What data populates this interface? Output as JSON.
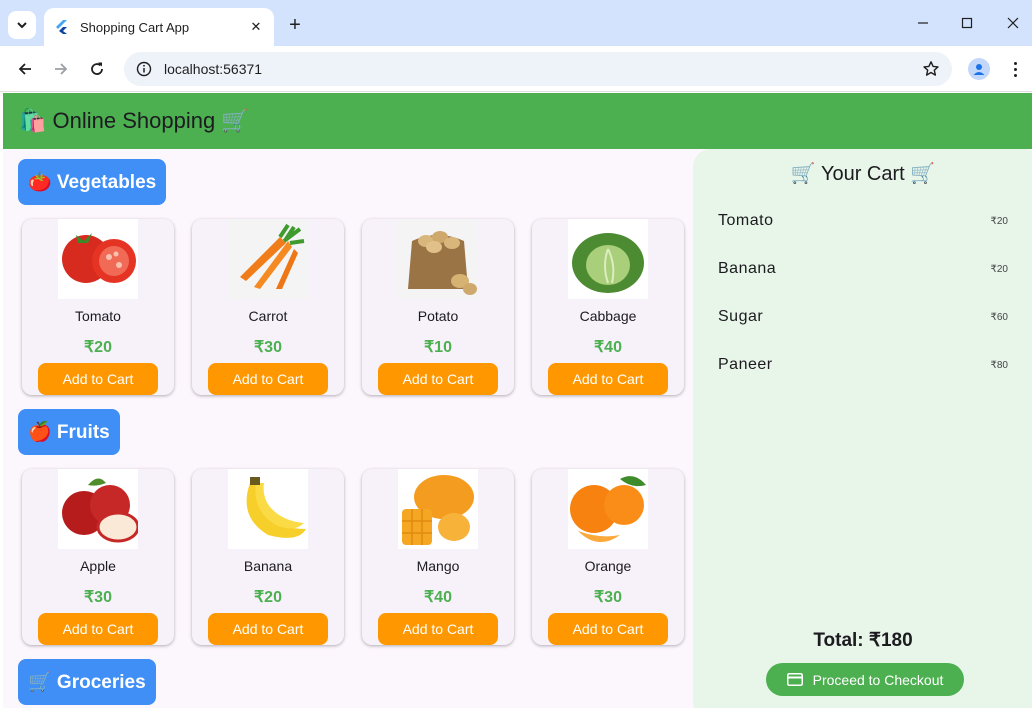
{
  "browser": {
    "tab_title": "Shopping Cart App",
    "url": "localhost:56371"
  },
  "app": {
    "title": "🛍️ Online Shopping 🛒"
  },
  "sections": [
    {
      "label": "🍅 Vegetables",
      "products": [
        {
          "name": "Tomato",
          "price": "₹20",
          "button": "Add to Cart"
        },
        {
          "name": "Carrot",
          "price": "₹30",
          "button": "Add to Cart"
        },
        {
          "name": "Potato",
          "price": "₹10",
          "button": "Add to Cart"
        },
        {
          "name": "Cabbage",
          "price": "₹40",
          "button": "Add to Cart"
        }
      ]
    },
    {
      "label": "🍎 Fruits",
      "products": [
        {
          "name": "Apple",
          "price": "₹30",
          "button": "Add to Cart"
        },
        {
          "name": "Banana",
          "price": "₹20",
          "button": "Add to Cart"
        },
        {
          "name": "Mango",
          "price": "₹40",
          "button": "Add to Cart"
        },
        {
          "name": "Orange",
          "price": "₹30",
          "button": "Add to Cart"
        }
      ]
    },
    {
      "label": "🛒 Groceries",
      "products": []
    }
  ],
  "cart": {
    "title": "🛒 Your Cart 🛒",
    "items": [
      {
        "name": "Tomato",
        "price": "₹20"
      },
      {
        "name": "Banana",
        "price": "₹20"
      },
      {
        "name": "Sugar",
        "price": "₹60"
      },
      {
        "name": "Paneer",
        "price": "₹80"
      }
    ],
    "total": "Total: ₹180",
    "checkout_label": "Proceed to Checkout"
  },
  "colors": {
    "appbar": "#4caf50",
    "section_chip": "#3f8ff7",
    "add_button": "#ff9800",
    "price": "#4caf50",
    "cart_bg": "#e8f5e9"
  },
  "icons": {
    "tab_search": "chevron-down-icon",
    "favicon": "flutter-icon",
    "back": "arrow-left-icon",
    "forward": "arrow-right-icon",
    "reload": "reload-icon",
    "site_info": "info-icon",
    "bookmark": "star-icon",
    "checkout": "credit-card-icon"
  }
}
